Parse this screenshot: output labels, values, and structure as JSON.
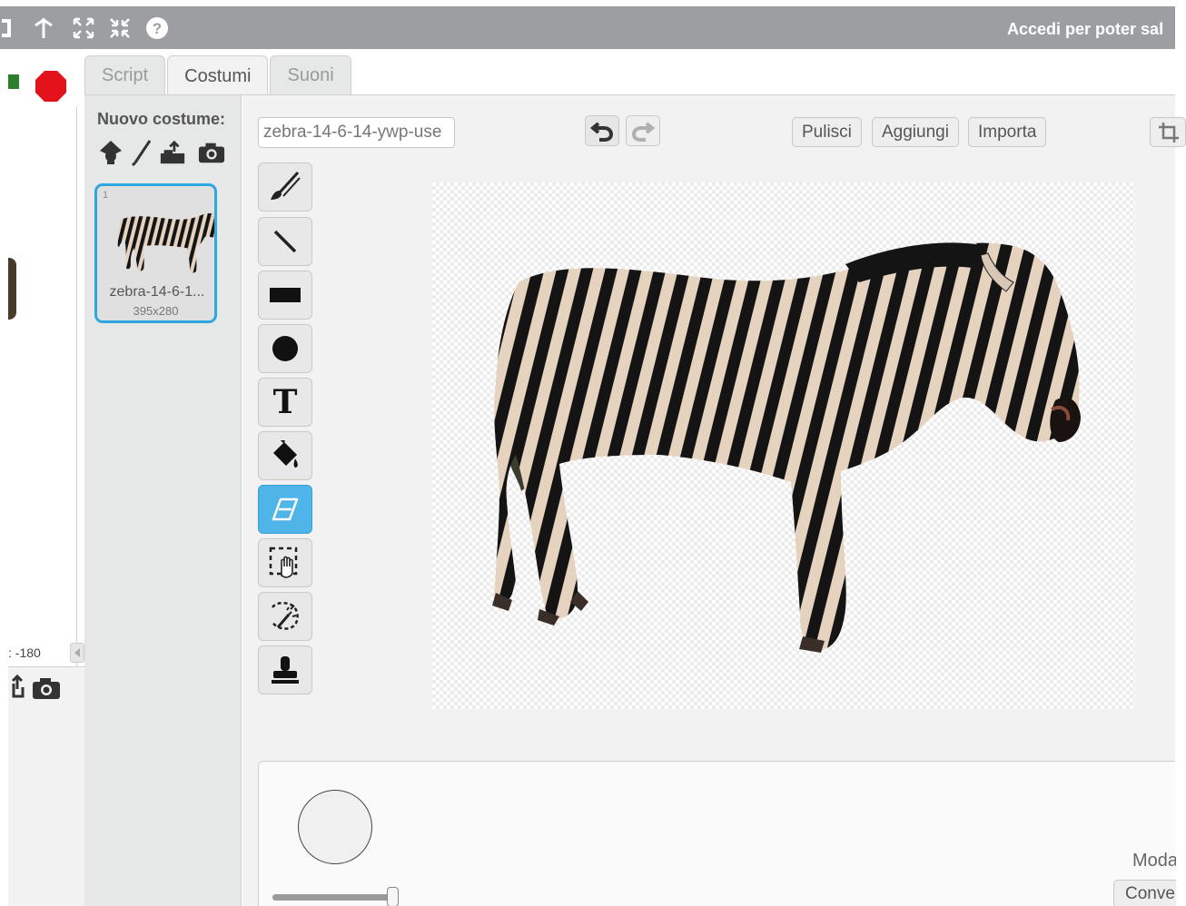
{
  "topbar": {
    "login_text": "Accedi per poter sal"
  },
  "stage": {
    "coord_text": ": -180"
  },
  "tabs": [
    {
      "label": "Script",
      "active": false
    },
    {
      "label": "Costumi",
      "active": true
    },
    {
      "label": "Suoni",
      "active": false
    }
  ],
  "costume_list": {
    "new_costume_label": "Nuovo costume:",
    "items": [
      {
        "number": "1",
        "name": "zebra-14-6-1...",
        "size": "395x280"
      }
    ]
  },
  "editor": {
    "costume_name": "zebra-14-6-14-ywp-use",
    "buttons": {
      "clear": "Pulisci",
      "add": "Aggiungi",
      "import": "Importa"
    },
    "tools": [
      {
        "icon": "brush-icon",
        "active": false
      },
      {
        "icon": "line-icon",
        "active": false
      },
      {
        "icon": "rectangle-icon",
        "active": false
      },
      {
        "icon": "ellipse-icon",
        "active": false
      },
      {
        "icon": "text-icon",
        "active": false
      },
      {
        "icon": "fill-bucket-icon",
        "active": false
      },
      {
        "icon": "eraser-icon",
        "active": true
      },
      {
        "icon": "select-icon",
        "active": false
      },
      {
        "icon": "magic-select-icon",
        "active": false
      },
      {
        "icon": "stamp-icon",
        "active": false
      }
    ],
    "text_tool_glyph": "T",
    "brush_size_level": 1.0,
    "mode_label": "Moda",
    "convert_label": "Conve"
  },
  "colors": {
    "topbar": "#9c9ea2",
    "accent": "#2ea6de",
    "stop": "#e3121b",
    "go": "#2c7f2c"
  }
}
